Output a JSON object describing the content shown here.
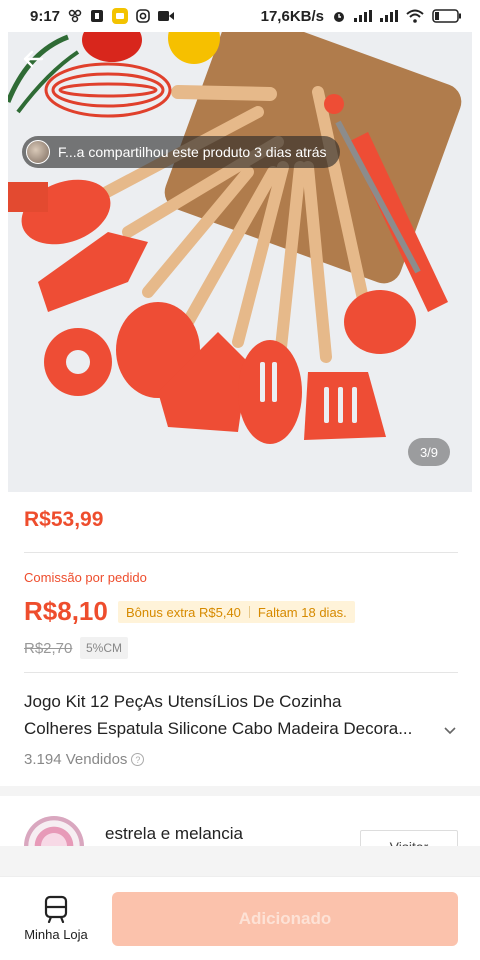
{
  "status_bar": {
    "time": "9:17",
    "network_speed": "17,6KB/s",
    "icons": [
      "hub-icon",
      "notification-icon",
      "app-icon",
      "instagram-icon",
      "video-icon",
      "alarm-icon",
      "signal-icon",
      "signal-icon",
      "wifi-icon",
      "battery-icon"
    ]
  },
  "hero": {
    "share_text": "F...a compartilhou este produto 3 dias atrás",
    "image_counter": "3/9",
    "colors": {
      "utensil": "#ee4d35",
      "wood": "#e6b98a",
      "board": "#b07c4c"
    }
  },
  "price": "R$53,99",
  "commission": {
    "label": "Comissão por pedido",
    "value": "R$8,10",
    "bonus": "Bônus extra R$5,40",
    "remaining": "Faltam 18 dias.",
    "old_value": "R$2,70",
    "rate": "5%CM"
  },
  "product": {
    "title_line1": "Jogo Kit 12 PeçAs UtensíLios De Cozinha",
    "title_line2": "Colheres Espatula Silicone Cabo Madeira Decora...",
    "sold": "3.194 Vendidos"
  },
  "shop": {
    "name": "estrela e melancia",
    "visit_label": "Visitar"
  },
  "bottom_bar": {
    "my_store_label": "Minha Loja",
    "add_label": "Adicionado"
  },
  "colors": {
    "accent": "#ee4d2d",
    "bonus_text": "#d68a00",
    "button_disabled": "#fbc2ac"
  }
}
